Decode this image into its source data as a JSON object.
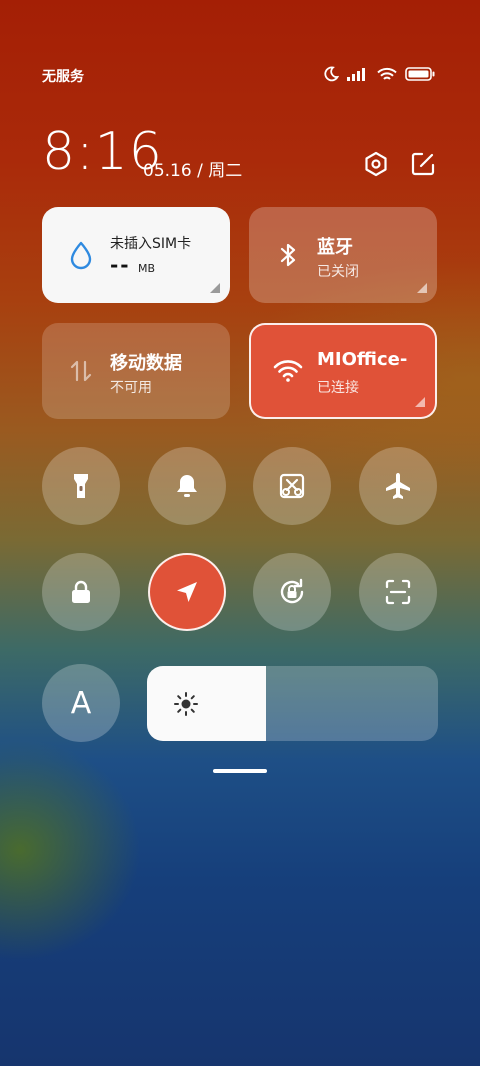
{
  "status_bar": {
    "carrier": "无服务",
    "icons": [
      "moon-icon",
      "signal-icon",
      "wifi-icon",
      "battery-icon"
    ]
  },
  "header": {
    "time": "8:16",
    "date": "05.16 / 周二",
    "icons": [
      "settings-icon",
      "edit-icon"
    ]
  },
  "tiles": {
    "sim": {
      "title": "未插入SIM卡",
      "value": "--",
      "unit": "MB",
      "icon": "water-drop-icon",
      "color": "#2f8ae0"
    },
    "bluetooth": {
      "title": "蓝牙",
      "status": "已关闭",
      "icon": "bluetooth-icon"
    },
    "mobile_data": {
      "title": "移动数据",
      "status": "不可用",
      "icon": "data-arrows-icon"
    },
    "wifi": {
      "title": "MIOffice-",
      "status": "已连接",
      "icon": "wifi-icon",
      "color": "#e05238"
    }
  },
  "toggles": [
    {
      "name": "flashlight",
      "icon": "flashlight-icon",
      "active": false
    },
    {
      "name": "sound",
      "icon": "bell-icon",
      "active": false
    },
    {
      "name": "screenshot",
      "icon": "screenshot-scissors-icon",
      "active": false
    },
    {
      "name": "airplane",
      "icon": "airplane-icon",
      "active": false
    },
    {
      "name": "lock-screen",
      "icon": "lock-icon",
      "active": false
    },
    {
      "name": "location",
      "icon": "location-arrow-icon",
      "active": true
    },
    {
      "name": "auto-rotate",
      "icon": "rotation-lock-icon",
      "active": false
    },
    {
      "name": "scanner",
      "icon": "scan-icon",
      "active": false
    }
  ],
  "auto_brightness_label": "A",
  "brightness": {
    "level": 0.41,
    "icon": "sun-icon"
  }
}
